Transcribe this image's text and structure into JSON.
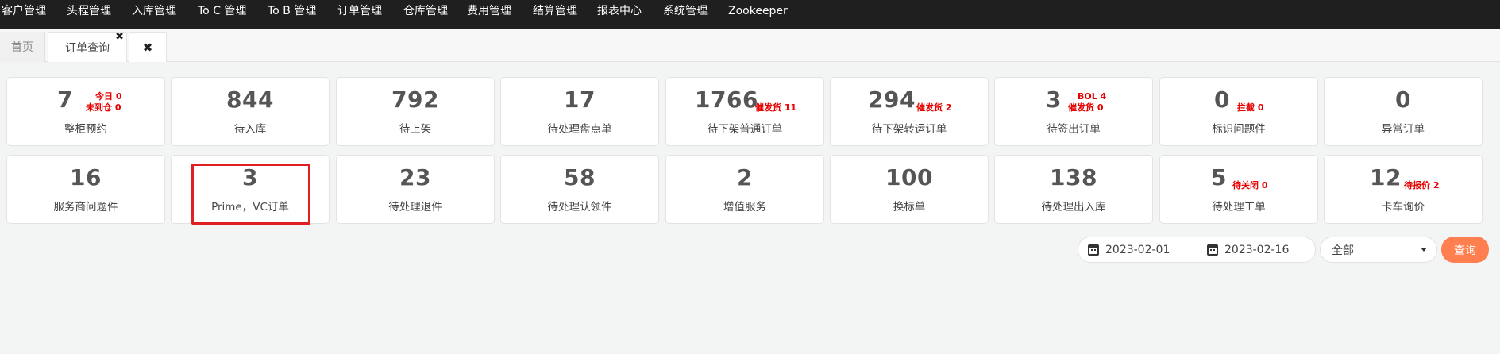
{
  "nav": {
    "items": [
      "客户管理",
      "头程管理",
      "入库管理",
      "To C 管理",
      "To B 管理",
      "订单管理",
      "仓库管理",
      "费用管理",
      "结算管理",
      "报表中心",
      "系统管理",
      "Zookeeper"
    ]
  },
  "tabs": {
    "home": "首页",
    "order": "订单查询",
    "close_icon": "✖",
    "closeall_icon": "✖"
  },
  "cards_row1": [
    {
      "num": "7",
      "label": "整柜预约",
      "extra": [
        "今日 0",
        "未到仓 0"
      ]
    },
    {
      "num": "844",
      "label": "待入库"
    },
    {
      "num": "792",
      "label": "待上架"
    },
    {
      "num": "17",
      "label": "待处理盘点单"
    },
    {
      "num": "1766",
      "label": "待下架普通订单",
      "extra": [
        "催发货 11"
      ]
    },
    {
      "num": "294",
      "label": "待下架转运订单",
      "extra": [
        "催发货 2"
      ]
    },
    {
      "num": "3",
      "label": "待签出订单",
      "extra": [
        "BOL 4",
        "催发货 0"
      ]
    },
    {
      "num": "0",
      "label": "标识问题件",
      "extra": [
        "拦截 0"
      ]
    },
    {
      "num": "0",
      "label": "异常订单"
    }
  ],
  "cards_row2": [
    {
      "num": "16",
      "label": "服务商问题件"
    },
    {
      "num": "3",
      "label": "Prime，VC订单"
    },
    {
      "num": "23",
      "label": "待处理退件"
    },
    {
      "num": "58",
      "label": "待处理认领件"
    },
    {
      "num": "2",
      "label": "增值服务"
    },
    {
      "num": "100",
      "label": "换标单"
    },
    {
      "num": "138",
      "label": "待处理出入库"
    },
    {
      "num": "5",
      "label": "待处理工单",
      "extra": [
        "待关闭 0"
      ]
    },
    {
      "num": "12",
      "label": "卡车询价",
      "extra": [
        "待报价 2"
      ]
    }
  ],
  "filter": {
    "date_start": "2023-02-01",
    "date_end": "2023-02-16",
    "select_value": "全部",
    "query_label": "查询"
  },
  "colors": {
    "nav_bg": "#1f1f1f",
    "alert": "#e60000",
    "highlight_border": "#e02020",
    "query_button": "#ff7f50"
  }
}
